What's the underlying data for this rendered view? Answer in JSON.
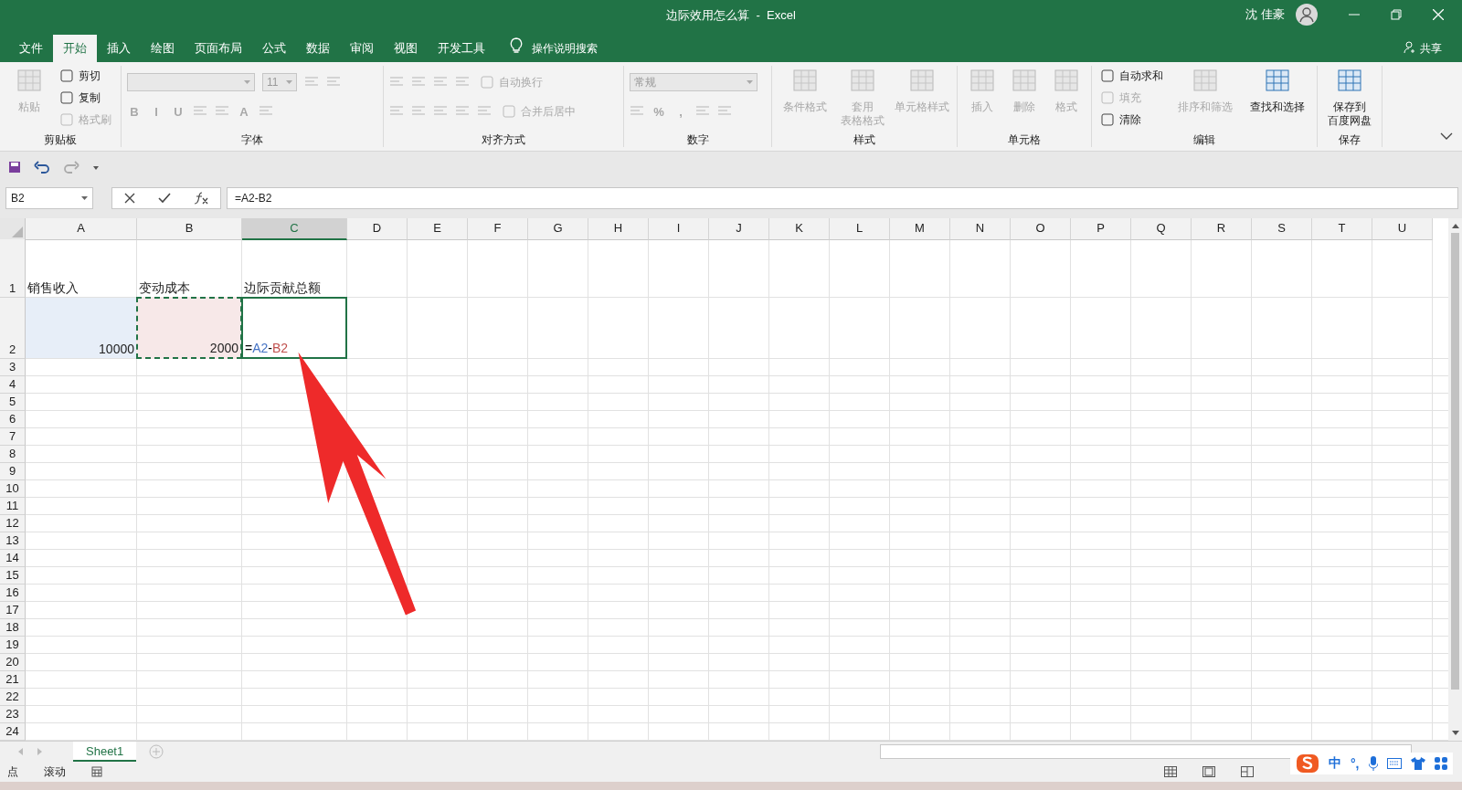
{
  "title_bar": {
    "document_title": "边际效用怎么算  -  Excel",
    "user": "沈 佳豪"
  },
  "menu_tabs": [
    {
      "label": "文件",
      "selected": false
    },
    {
      "label": "开始",
      "selected": true
    },
    {
      "label": "插入",
      "selected": false
    },
    {
      "label": "绘图",
      "selected": false
    },
    {
      "label": "页面布局",
      "selected": false
    },
    {
      "label": "公式",
      "selected": false
    },
    {
      "label": "数据",
      "selected": false
    },
    {
      "label": "审阅",
      "selected": false
    },
    {
      "label": "视图",
      "selected": false
    },
    {
      "label": "开发工具",
      "selected": false
    }
  ],
  "tell_me": "操作说明搜索",
  "share": "共享",
  "ribbon": [
    {
      "title": "剪贴板",
      "columns": [
        [
          {
            "kind": "large",
            "lines": [
              "粘贴"
            ],
            "disabled": true
          }
        ],
        [
          {
            "kind": "small",
            "label": "剪切",
            "disabled": false
          },
          {
            "kind": "small",
            "label": "复制",
            "disabled": false
          },
          {
            "kind": "small",
            "label": "格式刷",
            "disabled": true
          }
        ]
      ]
    },
    {
      "title": "字体",
      "rows": [
        [
          {
            "kind": "field",
            "wide": true
          },
          {
            "kind": "field",
            "value": "11",
            "wide": false
          },
          {
            "kind": "icon",
            "disabled": true
          },
          {
            "kind": "icon",
            "disabled": true
          }
        ],
        [
          {
            "kind": "glyph",
            "label": "B",
            "disabled": true
          },
          {
            "kind": "glyph",
            "label": "I",
            "disabled": true
          },
          {
            "kind": "glyph",
            "label": "U",
            "disabled": true
          },
          {
            "kind": "icon",
            "disabled": true
          },
          {
            "kind": "icon",
            "disabled": true
          },
          {
            "kind": "glyph",
            "label": "A",
            "disabled": true
          },
          {
            "kind": "icon",
            "disabled": true
          }
        ]
      ]
    },
    {
      "title": "对齐方式",
      "rows": [
        [
          {
            "kind": "icon",
            "disabled": true
          },
          {
            "kind": "icon",
            "disabled": true
          },
          {
            "kind": "icon",
            "disabled": true
          },
          {
            "kind": "icon",
            "disabled": true
          },
          {
            "kind": "small",
            "label": "自动换行",
            "disabled": true
          }
        ],
        [
          {
            "kind": "icon",
            "disabled": true
          },
          {
            "kind": "icon",
            "disabled": true
          },
          {
            "kind": "icon",
            "disabled": true
          },
          {
            "kind": "icon",
            "disabled": true
          },
          {
            "kind": "icon",
            "disabled": true
          },
          {
            "kind": "small",
            "label": "合并后居中",
            "disabled": true
          }
        ]
      ]
    },
    {
      "title": "数字",
      "rows": [
        [
          {
            "kind": "field",
            "value": "常规",
            "wide": true
          }
        ],
        [
          {
            "kind": "icon",
            "disabled": true
          },
          {
            "kind": "glyph",
            "label": "%",
            "disabled": true
          },
          {
            "kind": "glyph",
            "label": ",",
            "disabled": true
          },
          {
            "kind": "icon",
            "disabled": true
          },
          {
            "kind": "icon",
            "disabled": true
          }
        ]
      ]
    },
    {
      "title": "样式",
      "columns": [
        [
          {
            "kind": "large",
            "lines": [
              "条件格式"
            ],
            "disabled": true
          }
        ],
        [
          {
            "kind": "large",
            "lines": [
              "套用",
              "表格格式"
            ],
            "disabled": true
          }
        ],
        [
          {
            "kind": "large",
            "lines": [
              "单元格样式"
            ],
            "disabled": true
          }
        ]
      ]
    },
    {
      "title": "单元格",
      "columns": [
        [
          {
            "kind": "large",
            "lines": [
              "插入"
            ],
            "disabled": true
          }
        ],
        [
          {
            "kind": "large",
            "lines": [
              "删除"
            ],
            "disabled": true
          }
        ],
        [
          {
            "kind": "large",
            "lines": [
              "格式"
            ],
            "disabled": true
          }
        ]
      ]
    },
    {
      "title": "编辑",
      "columns": [
        [
          {
            "kind": "small",
            "label": "自动求和",
            "disabled": false
          },
          {
            "kind": "small",
            "label": "填充",
            "disabled": true
          },
          {
            "kind": "small",
            "label": "清除",
            "disabled": false
          }
        ],
        [
          {
            "kind": "large",
            "lines": [
              "排序和筛选"
            ],
            "disabled": true
          }
        ],
        [
          {
            "kind": "large",
            "lines": [
              "查找和选择"
            ],
            "disabled": false
          }
        ]
      ]
    },
    {
      "title": "保存",
      "columns": [
        [
          {
            "kind": "large",
            "lines": [
              "保存到",
              "百度网盘"
            ],
            "disabled": false
          }
        ]
      ]
    }
  ],
  "name_box": "B2",
  "formula": "=A2-B2",
  "columns": [
    {
      "label": "A",
      "selected": false
    },
    {
      "label": "B",
      "selected": false
    },
    {
      "label": "C",
      "selected": true
    },
    {
      "label": "D",
      "selected": false
    },
    {
      "label": "E",
      "selected": false
    },
    {
      "label": "F",
      "selected": false
    },
    {
      "label": "G",
      "selected": false
    },
    {
      "label": "H",
      "selected": false
    },
    {
      "label": "I",
      "selected": false
    },
    {
      "label": "J",
      "selected": false
    },
    {
      "label": "K",
      "selected": false
    },
    {
      "label": "L",
      "selected": false
    },
    {
      "label": "M",
      "selected": false
    },
    {
      "label": "N",
      "selected": false
    },
    {
      "label": "O",
      "selected": false
    },
    {
      "label": "P",
      "selected": false
    },
    {
      "label": "Q",
      "selected": false
    },
    {
      "label": "R",
      "selected": false
    },
    {
      "label": "S",
      "selected": false
    },
    {
      "label": "T",
      "selected": false
    },
    {
      "label": "U",
      "selected": false
    }
  ],
  "rows": [
    {
      "header": "1",
      "cells": [
        {
          "kind": "text",
          "text": "销售收入"
        },
        {
          "kind": "text",
          "text": "变动成本"
        },
        {
          "kind": "text",
          "text": "边际贡献总额"
        }
      ]
    },
    {
      "header": "2",
      "cells": [
        {
          "kind": "number",
          "text": "10000",
          "color": "#e7eef8"
        },
        {
          "kind": "number",
          "text": "2000",
          "color": "#f7e8e8",
          "marquee": true
        },
        {
          "kind": "formula",
          "active": true,
          "parts": [
            {
              "text": "=",
              "color": "#000000"
            },
            {
              "text": "A2",
              "color": "#4472c4"
            },
            {
              "text": "-",
              "color": "#000000"
            },
            {
              "text": "B2",
              "color": "#c0504d"
            }
          ]
        }
      ]
    },
    {
      "header": "3"
    },
    {
      "header": "4"
    },
    {
      "header": "5"
    },
    {
      "header": "6"
    },
    {
      "header": "7"
    },
    {
      "header": "8"
    },
    {
      "header": "9"
    },
    {
      "header": "10"
    },
    {
      "header": "11"
    },
    {
      "header": "12"
    },
    {
      "header": "13"
    },
    {
      "header": "14"
    },
    {
      "header": "15"
    },
    {
      "header": "16"
    },
    {
      "header": "17"
    },
    {
      "header": "18"
    },
    {
      "header": "19"
    },
    {
      "header": "20"
    },
    {
      "header": "21"
    },
    {
      "header": "22"
    },
    {
      "header": "23"
    },
    {
      "header": "24"
    }
  ],
  "sheet_tabs": [
    {
      "label": "Sheet1",
      "selected": true
    }
  ],
  "status_bar": {
    "items": [
      "点",
      "滚动"
    ]
  },
  "ime_toolbar": {
    "labels": [
      "中",
      "°,"
    ]
  }
}
